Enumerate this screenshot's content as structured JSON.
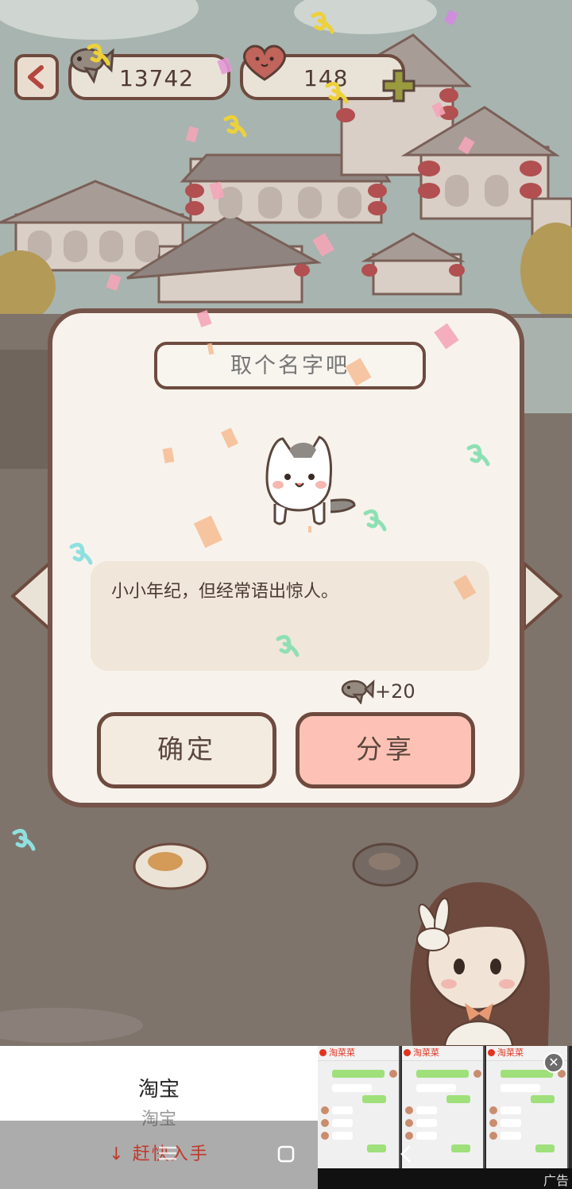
{
  "hud": {
    "fish_count": "13742",
    "heart_count": "148"
  },
  "dialog": {
    "name_placeholder": "取个名字吧",
    "description": "小小年纪，但经常语出惊人。",
    "reward": "+20",
    "confirm_label": "确定",
    "share_label": "分享"
  },
  "ad": {
    "title": "淘宝",
    "subtitle": "淘宝",
    "cta": "↓ 赶快入手",
    "brand": "淘菜菜",
    "label": "广告",
    "close": "✕"
  },
  "icons": {
    "back": "chevron-left-icon",
    "fish": "fish-icon",
    "heart": "heart-icon",
    "add": "plus-icon"
  },
  "colors": {
    "outline": "#6e4a3e",
    "panel": "#f7f3ec",
    "share_button": "#fdc2b5",
    "confirm_button": "#f3ebdf",
    "sky": "#a7b3ae"
  }
}
